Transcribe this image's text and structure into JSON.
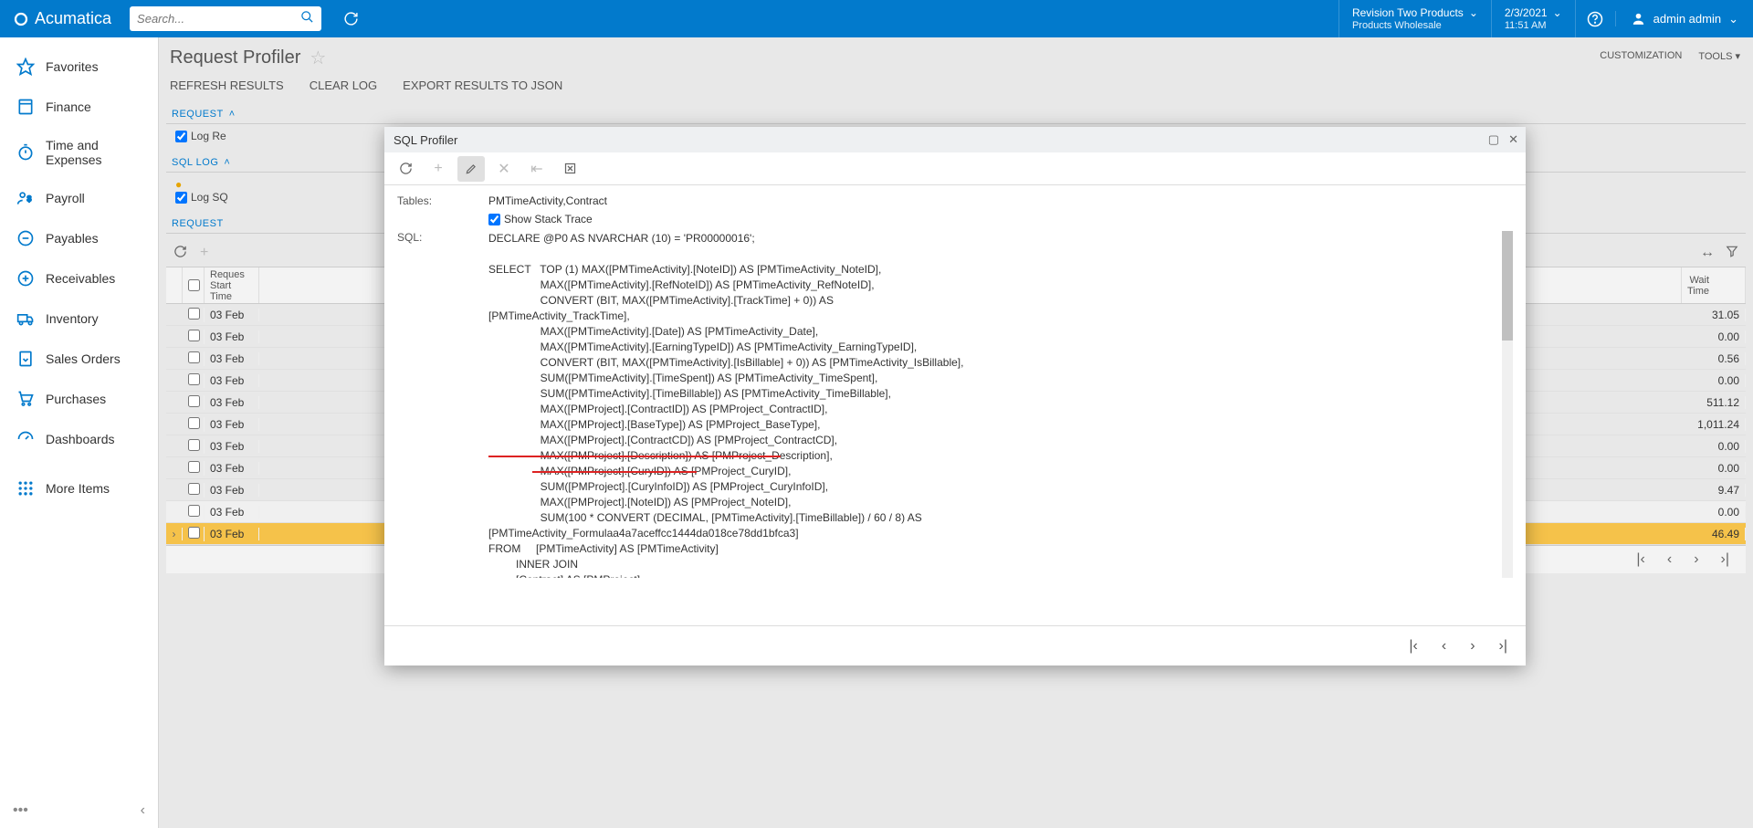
{
  "brand": "Acumatica",
  "search": {
    "placeholder": "Search..."
  },
  "tenant": {
    "line1": "Revision Two Products",
    "line2": "Products Wholesale"
  },
  "datetime": {
    "line1": "2/3/2021",
    "line2": "11:51 AM"
  },
  "user": "admin admin",
  "sidebar": {
    "items": [
      {
        "label": "Favorites"
      },
      {
        "label": "Finance"
      },
      {
        "label": "Time and Expenses"
      },
      {
        "label": "Payroll"
      },
      {
        "label": "Payables"
      },
      {
        "label": "Receivables"
      },
      {
        "label": "Inventory"
      },
      {
        "label": "Sales Orders"
      },
      {
        "label": "Purchases"
      },
      {
        "label": "Dashboards"
      }
    ],
    "more": "More Items"
  },
  "page": {
    "title": "Request Profiler",
    "topright": [
      "CUSTOMIZATION",
      "TOOLS"
    ],
    "actions": [
      "REFRESH RESULTS",
      "CLEAR LOG",
      "EXPORT RESULTS TO JSON"
    ]
  },
  "panels": {
    "request": {
      "header": "REQUEST",
      "checkbox": "Log Re"
    },
    "sqllog": {
      "header": "SQL LOG",
      "checkbox": "Log SQ"
    },
    "request2": {
      "header": "REQUEST"
    }
  },
  "grid": {
    "headers": {
      "start": "Reques\nStart\nTime",
      "wait": "Wait\nTime"
    },
    "rows": [
      {
        "date": "03 Feb",
        "wait": "31.05"
      },
      {
        "date": "03 Feb",
        "wait": "0.00"
      },
      {
        "date": "03 Feb",
        "wait": "0.56"
      },
      {
        "date": "03 Feb",
        "wait": "0.00"
      },
      {
        "date": "03 Feb",
        "wait": "511.12"
      },
      {
        "date": "03 Feb",
        "wait": "1,011.24"
      },
      {
        "date": "03 Feb",
        "wait": "0.00"
      },
      {
        "date": "03 Feb",
        "wait": "0.00"
      },
      {
        "date": "03 Feb",
        "wait": "9.47"
      },
      {
        "date": "03 Feb",
        "wait": "0.00"
      },
      {
        "date": "03 Feb",
        "wait": "46.49",
        "selected": true
      }
    ]
  },
  "modal": {
    "title": "SQL Profiler",
    "tables_label": "Tables:",
    "tables_value": "PMTimeActivity,Contract",
    "stack_label": "Show Stack Trace",
    "sql_label": "SQL:",
    "sql_text": "DECLARE @P0 AS NVARCHAR (10) = 'PR00000016';\n\nSELECT   TOP (1) MAX([PMTimeActivity].[NoteID]) AS [PMTimeActivity_NoteID],\n                 MAX([PMTimeActivity].[RefNoteID]) AS [PMTimeActivity_RefNoteID],\n                 CONVERT (BIT, MAX([PMTimeActivity].[TrackTime] + 0)) AS\n[PMTimeActivity_TrackTime],\n                 MAX([PMTimeActivity].[Date]) AS [PMTimeActivity_Date],\n                 MAX([PMTimeActivity].[EarningTypeID]) AS [PMTimeActivity_EarningTypeID],\n                 CONVERT (BIT, MAX([PMTimeActivity].[IsBillable] + 0)) AS [PMTimeActivity_IsBillable],\n                 SUM([PMTimeActivity].[TimeSpent]) AS [PMTimeActivity_TimeSpent],\n                 SUM([PMTimeActivity].[TimeBillable]) AS [PMTimeActivity_TimeBillable],\n                 MAX([PMProject].[ContractID]) AS [PMProject_ContractID],\n                 MAX([PMProject].[BaseType]) AS [PMProject_BaseType],\n                 MAX([PMProject].[ContractCD]) AS [PMProject_ContractCD],\n                 MAX([PMProject].[Description]) AS [PMProject_Description],\n                 MAX([PMProject].[CuryID]) AS [PMProject_CuryID],\n                 SUM([PMProject].[CuryInfoID]) AS [PMProject_CuryInfoID],\n                 MAX([PMProject].[NoteID]) AS [PMProject_NoteID],\n                 SUM(100 * CONVERT (DECIMAL, [PMTimeActivity].[TimeBillable]) / 60 / 8) AS\n[PMTimeActivity_Formulaa4a7aceffcc1444da018ce78dd1bfca3]\nFROM     [PMTimeActivity] AS [PMTimeActivity]\n         INNER JOIN\n         [Contract] AS [PMProject]\n         ON ([PMProject].[CompanyID] IN (1, 2)\n             AND 8 = SUBSTRING([PMProject].[CompanyMask], 1, 1) & 8)\n            AND [PMProject].[DeletedDatabaseRecord] = 0\n            AND ([PMTimeActivity].[ProjectID] = [PMProject].[ContractID])\nWHERE    ([PMTimeActivity].[CompanyID] = 2)\n         AND [PMTimeActivity].[DeletedDatabaseRecord] = 0\n         AND ([PMProject].[ContractCD] = @P0)\nGROUP BY [PMTimeActivity].[ProjectID], DATEPART(yyyy, [PMTimeActivity].[Date]) * 10000 +\n(DATEPART(mm, CASE WHEN DATEPART(yyyy, [PMTimeActivity].[Date]) >= 1"
  }
}
